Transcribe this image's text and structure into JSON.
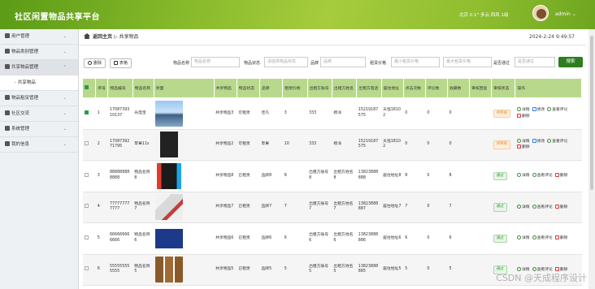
{
  "header": {
    "title": "社区闲置物品共享平台",
    "weather": "北京 0.1° 多云 西风 1级",
    "user": "admin"
  },
  "sidebar": {
    "items": [
      {
        "label": "用户管理",
        "icon": "users-icon"
      },
      {
        "label": "物品类别管理",
        "icon": "category-icon"
      },
      {
        "label": "共享物品管理",
        "icon": "box-icon",
        "active": true
      },
      {
        "label": "物品租赁管理",
        "icon": "rent-icon"
      },
      {
        "label": "社区交流",
        "icon": "chat-icon"
      },
      {
        "label": "系统管理",
        "icon": "gear-icon"
      },
      {
        "label": "我的信息",
        "icon": "user-icon"
      }
    ],
    "sub": "共享物品"
  },
  "breadcrumb": {
    "home": "返回主页",
    "sep": "▷",
    "current": "共享物品"
  },
  "datetime": "2024-2-24 9:49:57",
  "toolbar": {
    "delete": "删除",
    "export": "表格"
  },
  "filters": {
    "name_label": "物品名称",
    "name_ph": "物品名称",
    "status_label": "物品状态",
    "status_ph": "请选择物品状态",
    "brand_label": "品牌",
    "brand_ph": "品牌",
    "price_label": "租赁价格",
    "price_min": "最小租赁价格",
    "price_max": "最大租赁价格",
    "audit_label": "是否通过",
    "audit_ph": "是否通过",
    "search": "搜索"
  },
  "table": {
    "headers": [
      "序号",
      "物品编号",
      "物品名称",
      "封面",
      "共享物品",
      "物品状态",
      "品牌",
      "租赁价格",
      "出租方账号",
      "出租方姓名",
      "出租方电话",
      "居住地址",
      "点击次数",
      "评论数",
      "收藏数",
      "审核回复",
      "审核状态",
      "操作"
    ],
    "rows": [
      {
        "idx": "1",
        "code": "1708739310137",
        "name": "光电宝",
        "share": "共享物品3",
        "status": "可租赁",
        "brand": "佳凡",
        "price": "3",
        "acct": "333",
        "owner": "杨洋",
        "phone": "15219187575",
        "addr": "天恒18102",
        "clicks": "0",
        "comments": "0",
        "fav": "0",
        "reply": "",
        "audit": "待审核",
        "audit_type": "pend",
        "ops": [
          "详情",
          "修改",
          "查看评论",
          "删除"
        ],
        "checked": true,
        "thumb": "bridge"
      },
      {
        "idx": "2",
        "code": "1708739271795",
        "name": "苹果11s",
        "share": "共享物品2",
        "status": "可租赁",
        "brand": "苹果",
        "price": "10",
        "acct": "333",
        "owner": "杨洋",
        "phone": "15219187575",
        "addr": "天恒18102",
        "clicks": "0",
        "comments": "0",
        "fav": "0",
        "reply": "",
        "audit": "待审核",
        "audit_type": "pend",
        "ops": [
          "详情",
          "修改",
          "查看评论",
          "删除"
        ],
        "checked": false,
        "thumb": "phone"
      },
      {
        "idx": "3",
        "code": "888888888888",
        "name": "物品名称8",
        "share": "共享物品8",
        "status": "已租赁",
        "brand": "品牌8",
        "price": "8",
        "acct": "出租方账号8",
        "owner": "出租方姓名8",
        "phone": "13823888888",
        "addr": "居住地址8",
        "clicks": "8",
        "comments": "0",
        "fav": "8",
        "reply": "",
        "audit": "通过",
        "audit_type": "ok",
        "ops": [
          "详情",
          "查看评论",
          "删除"
        ],
        "checked": false,
        "thumb": "switch"
      },
      {
        "idx": "4",
        "code": "777777777777",
        "name": "物品名称7",
        "share": "共享物品7",
        "status": "已租赁",
        "brand": "品牌7",
        "price": "7",
        "acct": "出租方账号7",
        "owner": "出租方姓名7",
        "phone": "13823888887",
        "addr": "居住地址7",
        "clicks": "7",
        "comments": "0",
        "fav": "7",
        "reply": "",
        "audit": "通过",
        "audit_type": "ok",
        "ops": [
          "详情",
          "查看评论",
          "删除"
        ],
        "checked": false,
        "thumb": "wii"
      },
      {
        "idx": "5",
        "code": "666666666666",
        "name": "物品名称6",
        "share": "共享物品6",
        "status": "已租赁",
        "brand": "品牌6",
        "price": "6",
        "acct": "出租方账号6",
        "owner": "出租方姓名6",
        "phone": "13823888886",
        "addr": "居住地址6",
        "clicks": "6",
        "comments": "0",
        "fav": "6",
        "reply": "",
        "audit": "通过",
        "audit_type": "ok",
        "ops": [
          "详情",
          "查看评论",
          "删除"
        ],
        "checked": false,
        "thumb": "psv"
      },
      {
        "idx": "6",
        "code": "555555555555",
        "name": "物品名称5",
        "share": "共享物品5",
        "status": "已租赁",
        "brand": "品牌5",
        "price": "5",
        "acct": "出租方账号5",
        "owner": "出租方姓名5",
        "phone": "13823888885",
        "addr": "居住地址5",
        "clicks": "5",
        "comments": "0",
        "fav": "5",
        "reply": "",
        "audit": "通过",
        "audit_type": "ok",
        "ops": [
          "详情",
          "查看评论",
          "删除"
        ],
        "checked": false,
        "thumb": "speakers"
      }
    ]
  },
  "watermark": "CSDN @天成程序设计"
}
